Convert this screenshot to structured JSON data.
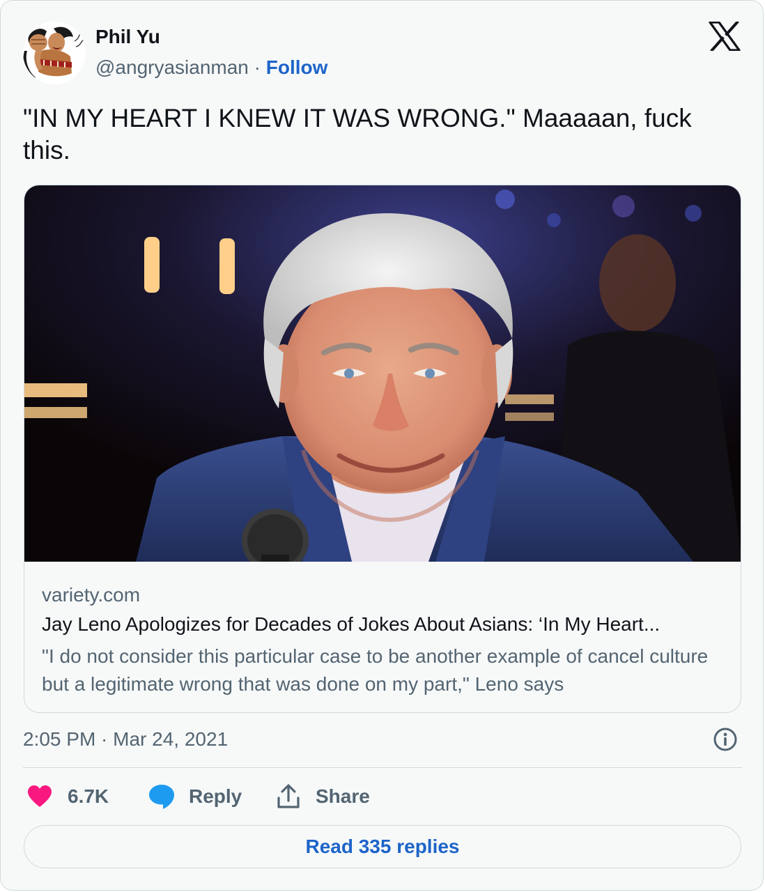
{
  "author": {
    "name": "Phil Yu",
    "handle": "@angryasianman",
    "separator": " · ",
    "follow_label": "Follow"
  },
  "tweet": {
    "text": "\"IN MY HEART I KNEW IT WAS WRONG.\" Maaaaan, fuck this."
  },
  "link_card": {
    "domain": "variety.com",
    "title": "Jay Leno Apologizes for Decades of Jokes About Asians: ‘In My Heart...",
    "description": "\"I do not consider this particular case to be another example of cancel culture but a legitimate wrong that was done on my part,\" Leno says"
  },
  "meta": {
    "timestamp": "2:05 PM · Mar 24, 2021"
  },
  "actions": {
    "likes_count": "6.7K",
    "reply_label": "Reply",
    "share_label": "Share"
  },
  "replies_button_label": "Read 335 replies",
  "icons": {
    "platform": "x-logo-icon",
    "like": "heart-icon",
    "reply": "speech-bubble-icon",
    "share": "share-upload-icon",
    "info": "info-icon"
  },
  "colors": {
    "accent": "#1d64c9",
    "like": "#f91880",
    "reply": "#1d9bf0",
    "muted_text": "#536471",
    "card_background": "#f7f9f9",
    "border": "#cfd9de"
  }
}
